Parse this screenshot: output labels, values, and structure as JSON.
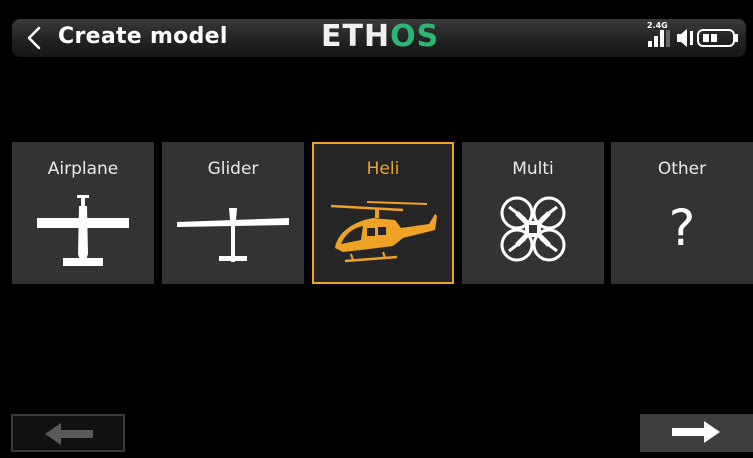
{
  "header": {
    "title": "Create model",
    "brand_part1": "ETH",
    "brand_part2": "OS",
    "band": "2.4G",
    "accent": "#2bb673"
  },
  "model_types": [
    {
      "label": "Airplane",
      "icon": "airplane-icon",
      "selected": false
    },
    {
      "label": "Glider",
      "icon": "glider-icon",
      "selected": false
    },
    {
      "label": "Heli",
      "icon": "helicopter-icon",
      "selected": true
    },
    {
      "label": "Multi",
      "icon": "quadcopter-icon",
      "selected": false
    },
    {
      "label": "Other",
      "icon": "question-mark-icon",
      "selected": false
    }
  ],
  "other_symbol": "?",
  "selection_color": "#f0a227",
  "nav": {
    "previous": "arrow-left-icon",
    "next": "arrow-right-icon"
  }
}
